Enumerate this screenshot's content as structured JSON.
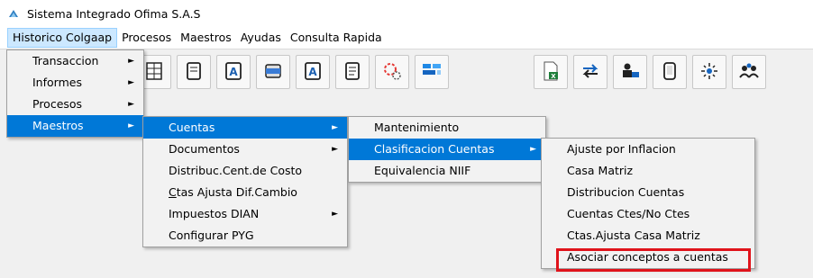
{
  "window": {
    "title": "Sistema Integrado Ofima S.A.S",
    "icon": "app-logo-icon"
  },
  "menubar": {
    "items": [
      {
        "label": "Historico Colgaap",
        "active": true
      },
      {
        "label": "Procesos"
      },
      {
        "label": "Maestros"
      },
      {
        "label": "Ayudas"
      },
      {
        "label": "Consulta Rapida"
      }
    ]
  },
  "toolbar": {
    "buttons": [
      {
        "icon": "grid-calculator-icon"
      },
      {
        "icon": "document-icon"
      },
      {
        "icon": "letter-a-document-icon"
      },
      {
        "icon": "xlsx-export-icon"
      },
      {
        "icon": "letter-a-edit-icon"
      },
      {
        "icon": "notepad-icon"
      },
      {
        "icon": "settings-gears-icon"
      },
      {
        "icon": "structure-tree-icon"
      },
      {
        "icon": "excel-sheet-icon"
      },
      {
        "icon": "transfer-arrows-icon"
      },
      {
        "icon": "users-computer-icon"
      },
      {
        "icon": "device-icon"
      },
      {
        "icon": "sparkle-icon"
      },
      {
        "icon": "people-group-icon"
      }
    ]
  },
  "menu_level1": {
    "items": [
      {
        "label": "Transaccion",
        "has_submenu": true
      },
      {
        "label": "Informes",
        "has_submenu": true
      },
      {
        "label": "Procesos",
        "has_submenu": true
      },
      {
        "label": "Maestros",
        "has_submenu": true,
        "selected": true
      }
    ]
  },
  "menu_level2": {
    "items": [
      {
        "label": "Cuentas",
        "has_submenu": true,
        "selected": true
      },
      {
        "label": "Documentos",
        "has_submenu": true
      },
      {
        "label": "Distribuc.Cent.de Costo"
      },
      {
        "label_underlined": "C",
        "label_rest": "tas Ajusta Dif.Cambio"
      },
      {
        "label": "Impuestos DIAN",
        "has_submenu": true
      },
      {
        "label": "Configurar PYG"
      }
    ]
  },
  "menu_level3": {
    "items": [
      {
        "label": "Mantenimiento"
      },
      {
        "label": "Clasificacion Cuentas",
        "has_submenu": true,
        "selected": true
      },
      {
        "label": "Equivalencia NIIF"
      }
    ]
  },
  "menu_level4": {
    "items": [
      {
        "label": "Ajuste por Inflacion"
      },
      {
        "label": "Casa Matriz"
      },
      {
        "label": "Distribucion Cuentas"
      },
      {
        "label": "Cuentas Ctes/No Ctes"
      },
      {
        "label": "Ctas.Ajusta Casa Matriz"
      },
      {
        "label": "Asociar conceptos a cuentas",
        "highlighted": true
      }
    ]
  },
  "colors": {
    "selection": "#0078d7",
    "highlight_border": "#e0131b",
    "menubar_active": "#cce8ff"
  },
  "submenu_arrow": "►"
}
